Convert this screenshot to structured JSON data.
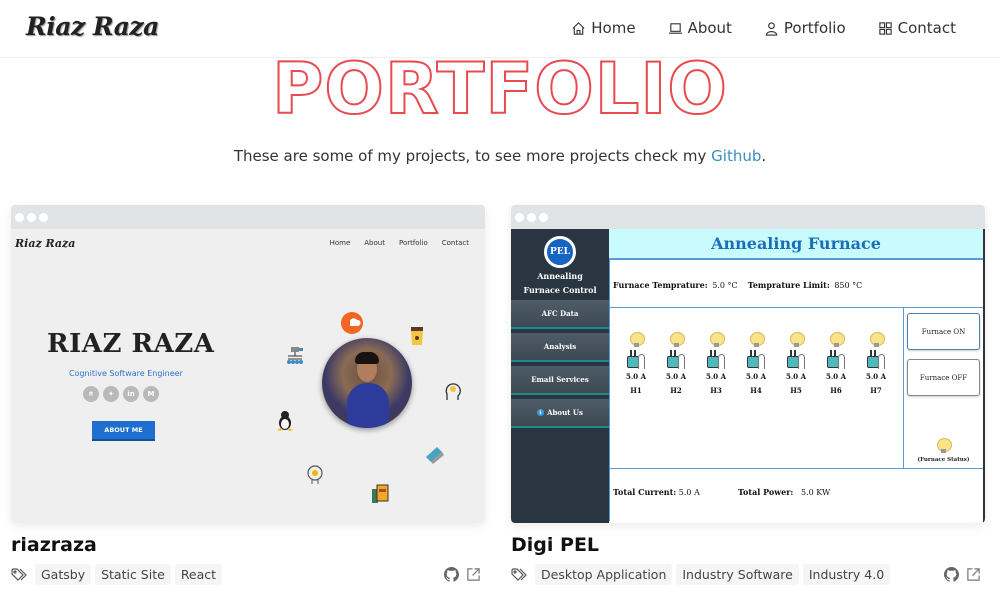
{
  "header": {
    "logo": "Riaz Raza",
    "nav": [
      {
        "label": "Home",
        "icon": "home-icon"
      },
      {
        "label": "About",
        "icon": "laptop-icon"
      },
      {
        "label": "Portfolio",
        "icon": "user-icon"
      },
      {
        "label": "Contact",
        "icon": "grid-icon"
      }
    ]
  },
  "page": {
    "title": "PORTFOLIO",
    "subtitle_prefix": "These are some of my projects, to see more projects check my ",
    "subtitle_link": "Github",
    "subtitle_suffix": ".",
    "title_color": "#e84a4f",
    "link_color": "#3b8bc4"
  },
  "projects": [
    {
      "title": "riazraza",
      "tags": [
        "Gatsby",
        "Static Site",
        "React"
      ],
      "preview": {
        "logo": "Riaz Raza",
        "nav": [
          "Home",
          "About",
          "Portfolio",
          "Contact"
        ],
        "name": "RIAZ RAZA",
        "role": "Cognitive Software Engineer",
        "social": [
          "github",
          "twitter",
          "linkedin",
          "medium"
        ],
        "social_glyphs": [
          "⌾",
          "✦",
          "in",
          "M"
        ],
        "button": "ABOUT ME"
      }
    },
    {
      "title": "Digi PEL",
      "tags": [
        "Desktop Application",
        "Industry Software",
        "Industry 4.0"
      ],
      "preview": {
        "badge": "PEL",
        "side_title_1": "Annealing",
        "side_title_2": "Furnace Control",
        "menu": [
          "AFC Data",
          "Analysis",
          "Email Services",
          "About Us"
        ],
        "header": "Annealing Furnace",
        "temp_label": "Furnace Temprature:",
        "temp_value": "5.0 °C",
        "limit_label": "Temprature Limit:",
        "limit_value": "850 °C",
        "heaters": [
          {
            "amp": "5.0 A",
            "name": "H1"
          },
          {
            "amp": "5.0 A",
            "name": "H2"
          },
          {
            "amp": "5.0 A",
            "name": "H3"
          },
          {
            "amp": "5.0 A",
            "name": "H4"
          },
          {
            "amp": "5.0 A",
            "name": "H5"
          },
          {
            "amp": "5.0 A",
            "name": "H6"
          },
          {
            "amp": "5.0 A",
            "name": "H7"
          }
        ],
        "btn_on": "Furnace ON",
        "btn_off": "Furnace OFF",
        "status_label": "(Furnace Status)",
        "current_label": "Total Current:",
        "current_value": "5.0 A",
        "power_label": "Total Power:",
        "power_value": "5.0 KW"
      }
    }
  ]
}
